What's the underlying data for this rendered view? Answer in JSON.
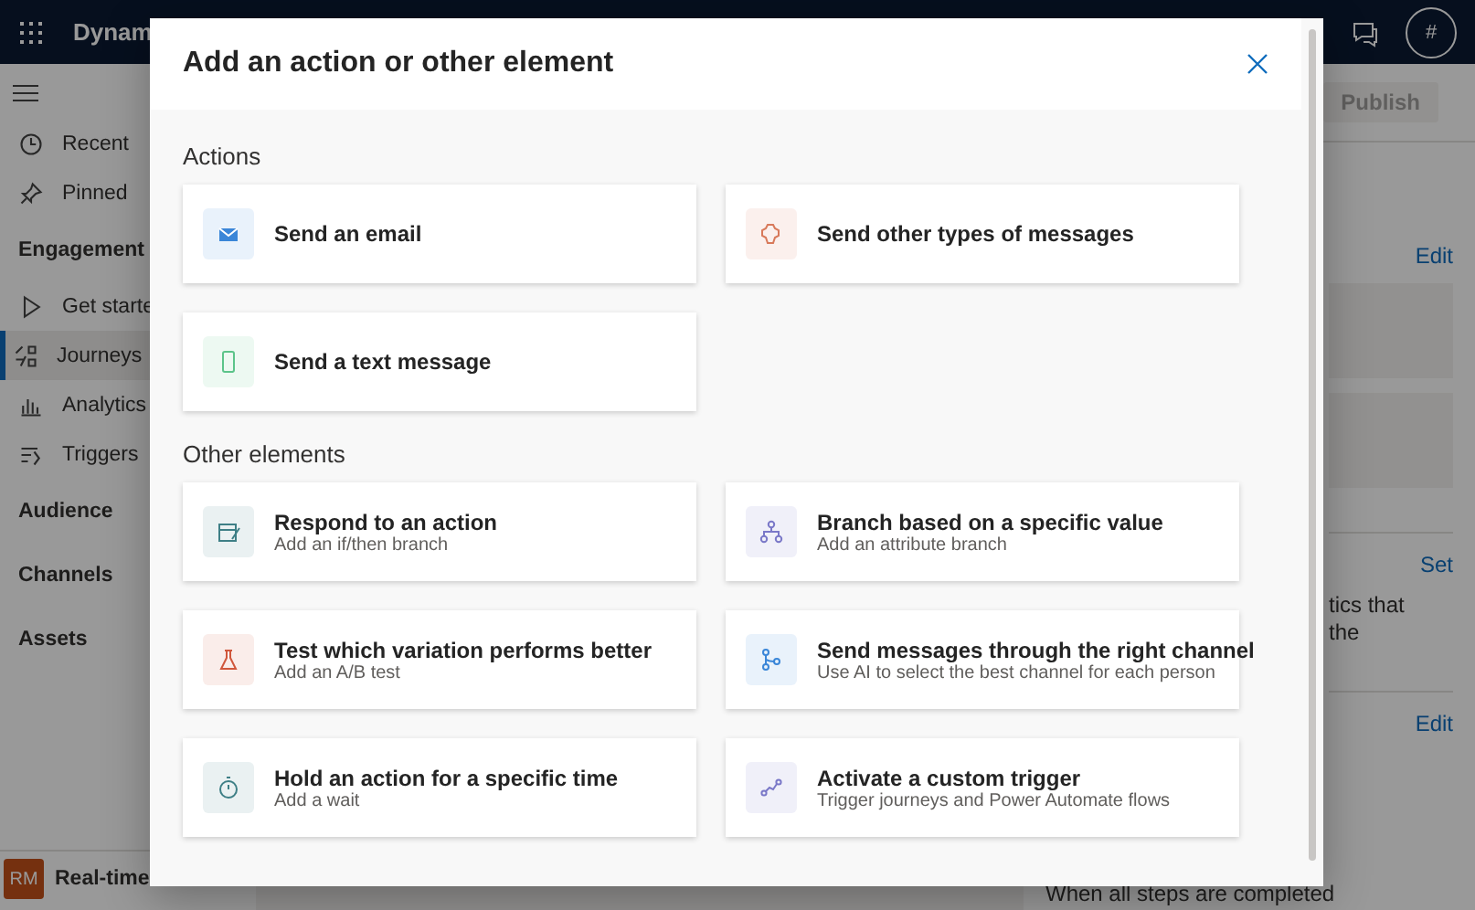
{
  "top_bar": {
    "app_name": "Dynam",
    "avatar": "#"
  },
  "command_bar": {
    "publish": {
      "label": "Publish",
      "disabled": true
    }
  },
  "sidebar": {
    "items": [
      {
        "kind": "item",
        "label": "Recent",
        "selected": false
      },
      {
        "kind": "item",
        "label": "Pinned",
        "selected": false
      },
      {
        "kind": "header",
        "label": "Engagement"
      },
      {
        "kind": "item",
        "label": "Get starte",
        "selected": false
      },
      {
        "kind": "item",
        "label": "Journeys",
        "selected": true
      },
      {
        "kind": "item",
        "label": "Analytics",
        "selected": false
      },
      {
        "kind": "item",
        "label": "Triggers",
        "selected": false
      },
      {
        "kind": "header",
        "label": "Audience"
      },
      {
        "kind": "header",
        "label": "Channels"
      },
      {
        "kind": "header",
        "label": "Assets"
      }
    ],
    "area": {
      "initials": "RM",
      "label": "Real-time"
    }
  },
  "details_panel": {
    "links": [
      "Edit",
      "Set",
      "Edit"
    ],
    "text_lines": [
      "tics that",
      "the"
    ],
    "footer": "When all steps are completed"
  },
  "dialog": {
    "title": "Add an action or other element",
    "sections": [
      {
        "heading": "Actions",
        "cards": [
          {
            "color": "#3a86d8",
            "title": "Send an email"
          },
          {
            "color": "#d8795a",
            "title": "Send other types of messages"
          },
          {
            "color": "#5cc48a",
            "title": "Send a text message"
          }
        ]
      },
      {
        "heading": "Other elements",
        "cards": [
          {
            "color": "#3e7f86",
            "title": "Respond to an action",
            "subtitle": "Add an if/then branch"
          },
          {
            "color": "#7a78c8",
            "title": "Branch based on a specific value",
            "subtitle": "Add an attribute branch"
          },
          {
            "color": "#d0573c",
            "title": "Test which variation performs better",
            "subtitle": "Add an A/B test"
          },
          {
            "color": "#3a86d8",
            "title": "Send messages through the right channel",
            "subtitle": "Use AI to select the best channel for each person"
          },
          {
            "color": "#3e7f86",
            "title": "Hold an action for a specific time",
            "subtitle": "Add a wait"
          },
          {
            "color": "#7a78c8",
            "title": "Activate a custom trigger",
            "subtitle": "Trigger journeys and Power Automate flows"
          }
        ]
      }
    ]
  }
}
